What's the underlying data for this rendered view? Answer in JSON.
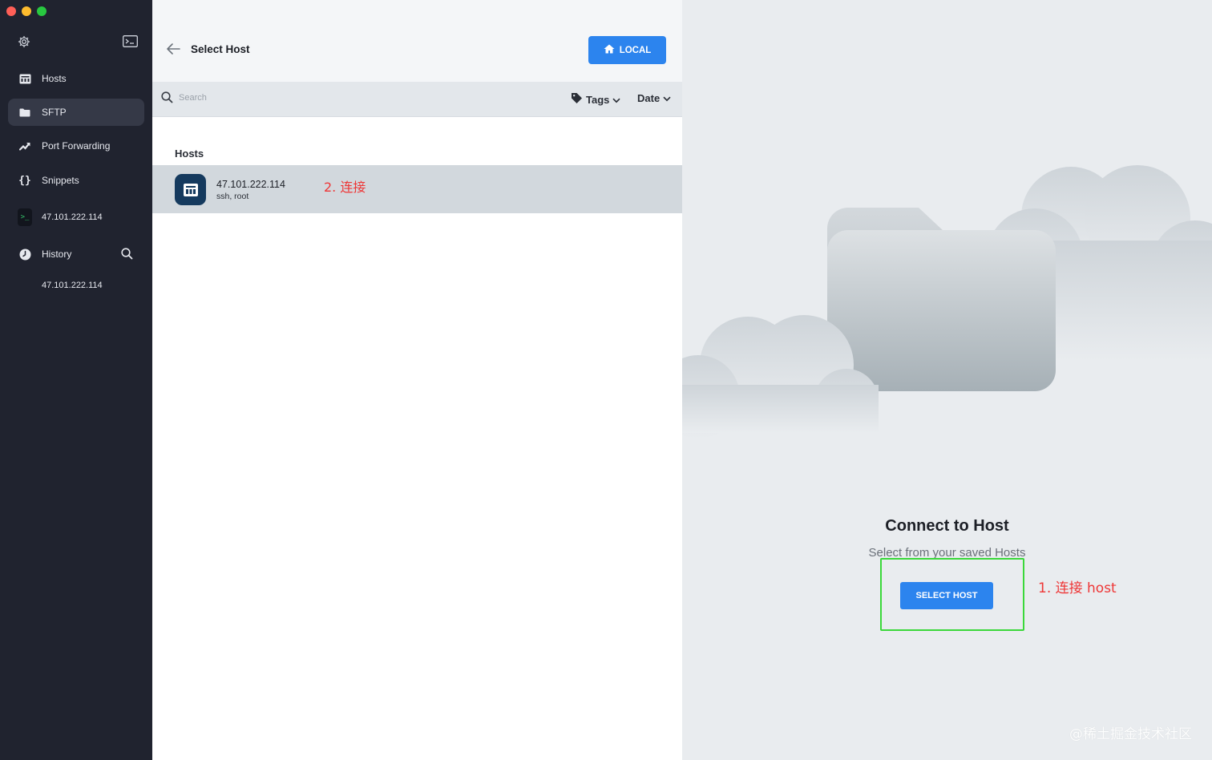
{
  "window": {
    "traffic_lights": [
      "close",
      "minimize",
      "zoom"
    ]
  },
  "sidebar": {
    "items": [
      {
        "label": "Hosts",
        "icon": "hosts-icon"
      },
      {
        "label": "SFTP",
        "icon": "folder-icon",
        "active": true
      },
      {
        "label": "Port Forwarding",
        "icon": "port-forward-icon"
      },
      {
        "label": "Snippets",
        "icon": "braces-icon"
      },
      {
        "label": "47.101.222.114",
        "icon": "terminal-icon"
      },
      {
        "label": "History",
        "icon": "clock-icon"
      }
    ],
    "history_entry": "47.101.222.114"
  },
  "middle": {
    "title": "Select Host",
    "local_button": "LOCAL",
    "search_placeholder": "Search",
    "tags_label": "Tags",
    "date_label": "Date",
    "section_label": "Hosts",
    "hosts": [
      {
        "name": "47.101.222.114",
        "sub": "ssh, root"
      }
    ],
    "annotation": "2. 连接"
  },
  "right": {
    "title": "Connect to Host",
    "subtitle": "Select from your saved Hosts",
    "button": "SELECT HOST",
    "annotation": "1. 连接 host",
    "watermark": "@稀土掘金技术社区"
  },
  "colors": {
    "sidebar_bg": "#20232f",
    "accent_blue": "#2c84ee",
    "annotation_red": "#ee3636",
    "highlight_green": "#3ad83a",
    "selected_row": "#d2d8dd"
  }
}
